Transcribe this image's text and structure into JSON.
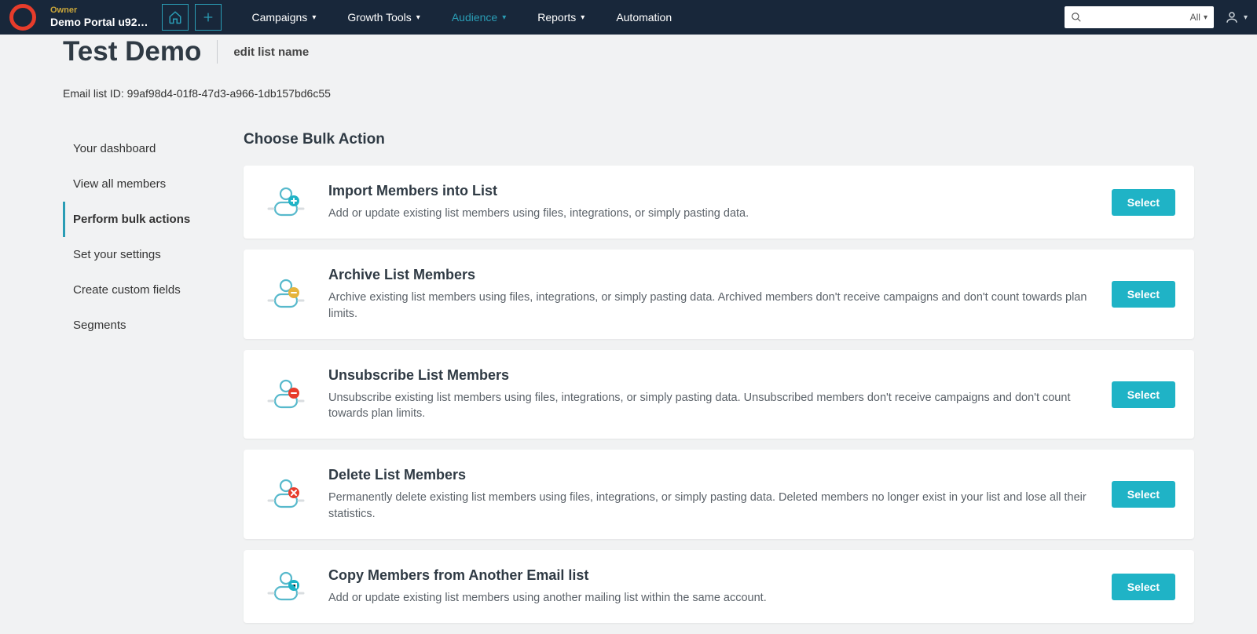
{
  "header": {
    "owner_label": "Owner",
    "owner_name": "Demo Portal u92…",
    "nav": [
      {
        "label": "Campaigns",
        "dropdown": true,
        "active": false
      },
      {
        "label": "Growth Tools",
        "dropdown": true,
        "active": false
      },
      {
        "label": "Audience",
        "dropdown": true,
        "active": true
      },
      {
        "label": "Reports",
        "dropdown": true,
        "active": false
      },
      {
        "label": "Automation",
        "dropdown": false,
        "active": false
      }
    ],
    "search_filter": "All"
  },
  "page": {
    "title": "Test Demo",
    "edit_label": "edit list name",
    "list_id_label": "Email list ID: 99af98d4-01f8-47d3-a966-1db157bd6c55"
  },
  "sidebar": {
    "items": [
      {
        "label": "Your dashboard",
        "active": false
      },
      {
        "label": "View all members",
        "active": false
      },
      {
        "label": "Perform bulk actions",
        "active": true
      },
      {
        "label": "Set your settings",
        "active": false
      },
      {
        "label": "Create custom fields",
        "active": false
      },
      {
        "label": "Segments",
        "active": false
      }
    ]
  },
  "main": {
    "heading": "Choose Bulk Action",
    "select_label": "Select",
    "actions": [
      {
        "title": "Import Members into List",
        "desc": "Add or update existing list members using files, integrations, or simply pasting data.",
        "badge": "plus"
      },
      {
        "title": "Archive List Members",
        "desc": "Archive existing list members using files, integrations, or simply pasting data. Archived members don't receive campaigns and don't count towards plan limits.",
        "badge": "minus"
      },
      {
        "title": "Unsubscribe List Members",
        "desc": "Unsubscribe existing list members using files, integrations, or simply pasting data. Unsubscribed members don't receive campaigns and don't count towards plan limits.",
        "badge": "remove"
      },
      {
        "title": "Delete List Members",
        "desc": "Permanently delete existing list members using files, integrations, or simply pasting data. Deleted members no longer exist in your list and lose all their statistics.",
        "badge": "delete"
      },
      {
        "title": "Copy Members from Another Email list",
        "desc": "Add or update existing list members using another mailing list within the same account.",
        "badge": "copy"
      }
    ]
  }
}
